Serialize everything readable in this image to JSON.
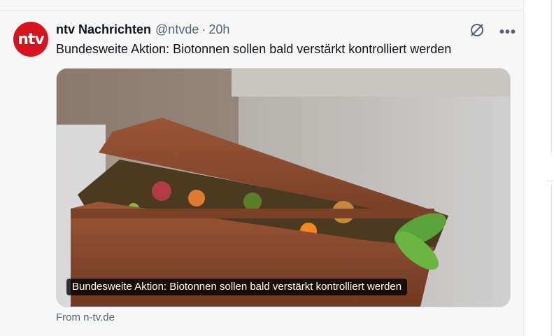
{
  "tweet": {
    "author_name": "ntv Nachrichten",
    "handle": "@ntvde",
    "separator": "·",
    "time": "20h",
    "text": "Bundesweite Aktion: Biotonnen sollen bald verstärkt kontrolliert werden",
    "avatar_text": "ntv",
    "card_caption": "Bundesweite Aktion: Biotonnen sollen bald verstärkt kontrolliert werden",
    "source": "From n-tv.de"
  },
  "icons": {
    "grok": "grok-icon",
    "more": "more-icon"
  },
  "colors": {
    "brand": "#d9131d",
    "secondary_text": "#536471",
    "bin_brown": "#8a4b2e"
  }
}
